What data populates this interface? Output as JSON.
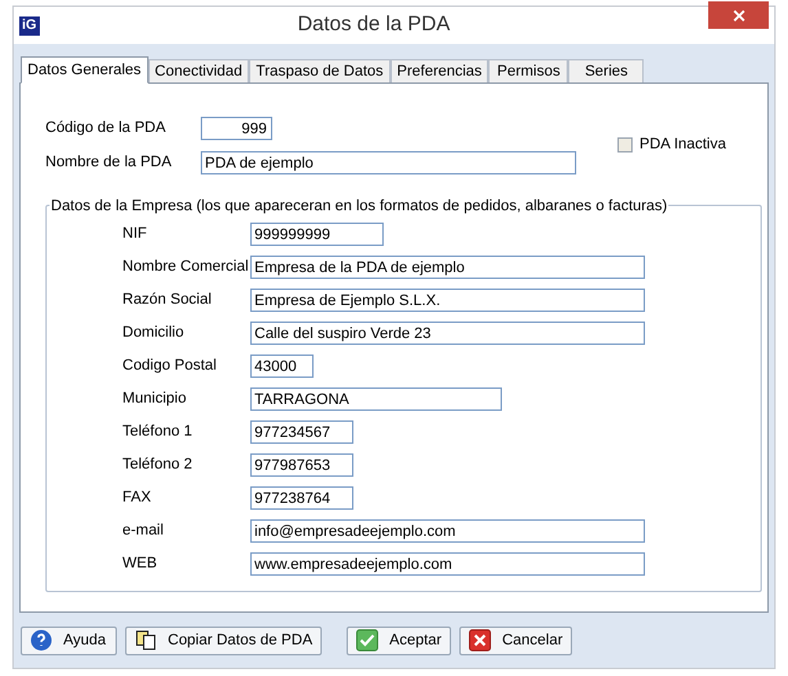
{
  "window": {
    "title": "Datos de la PDA",
    "logo": "iG"
  },
  "tabs": [
    {
      "label": "Datos Generales",
      "selected": true
    },
    {
      "label": "Conectividad",
      "selected": false
    },
    {
      "label": "Traspaso de Datos",
      "selected": false
    },
    {
      "label": "Preferencias",
      "selected": false
    },
    {
      "label": "Permisos",
      "selected": false
    },
    {
      "label": "Series",
      "selected": false
    }
  ],
  "pda": {
    "code_label": "Código de la PDA",
    "code": "999",
    "name_label": "Nombre de la PDA",
    "name": "PDA de ejemplo",
    "inactive_label": "PDA Inactiva",
    "inactive": false
  },
  "company": {
    "title": "Datos de la Empresa (los que apareceran en los formatos de pedidos, albaranes o facturas)",
    "fields": [
      {
        "label": "NIF",
        "value": "999999999"
      },
      {
        "label": "Nombre Comercial",
        "value": "Empresa de la PDA de ejemplo"
      },
      {
        "label": "Razón Social",
        "value": "Empresa de Ejemplo S.L.X."
      },
      {
        "label": "Domicilio",
        "value": "Calle del suspiro Verde 23"
      },
      {
        "label": "Codigo Postal",
        "value": "43000"
      },
      {
        "label": "Municipio",
        "value": "TARRAGONA"
      },
      {
        "label": "Teléfono 1",
        "value": "977234567"
      },
      {
        "label": "Teléfono 2",
        "value": "977987653"
      },
      {
        "label": "FAX",
        "value": "977238764"
      },
      {
        "label": "e-mail",
        "value": "info@empresadeejemplo.com"
      },
      {
        "label": "WEB",
        "value": "www.empresadeejemplo.com"
      }
    ]
  },
  "buttons": [
    {
      "kind": "help",
      "label": "Ayuda"
    },
    {
      "kind": "copy",
      "label": "Copiar Datos de PDA"
    },
    {
      "kind": "accept",
      "label": "Aceptar"
    },
    {
      "kind": "cancel",
      "label": "Cancelar"
    }
  ]
}
